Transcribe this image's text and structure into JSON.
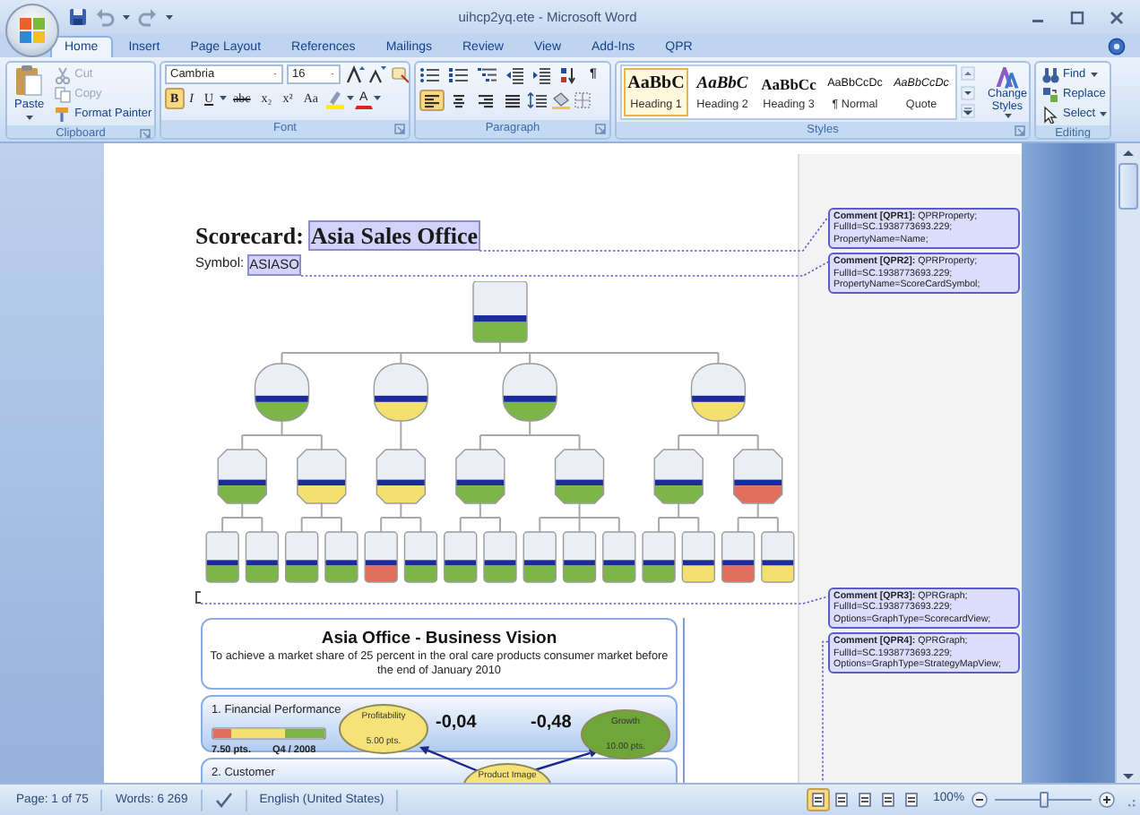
{
  "window": {
    "title": "uihcp2yq.ete - Microsoft Word"
  },
  "tabs": [
    {
      "label": "Home",
      "selected": true
    },
    {
      "label": "Insert",
      "selected": false
    },
    {
      "label": "Page Layout",
      "selected": false
    },
    {
      "label": "References",
      "selected": false
    },
    {
      "label": "Mailings",
      "selected": false
    },
    {
      "label": "Review",
      "selected": false
    },
    {
      "label": "View",
      "selected": false
    },
    {
      "label": "Add-Ins",
      "selected": false
    },
    {
      "label": "QPR",
      "selected": false
    }
  ],
  "ribbon": {
    "clipboard": {
      "label": "Clipboard",
      "paste": "Paste",
      "items": [
        {
          "label": "Cut",
          "kind": "cut",
          "disabled": true
        },
        {
          "label": "Copy",
          "kind": "copy",
          "disabled": true
        },
        {
          "label": "Format Painter",
          "kind": "format_painter",
          "disabled": false
        }
      ]
    },
    "font": {
      "label": "Font",
      "font_name": "Cambria",
      "font_size": "16",
      "format_buttons": [
        {
          "label": "B",
          "kind": "bold",
          "selected": true
        },
        {
          "label": "I",
          "kind": "italic",
          "selected": false
        },
        {
          "label": "U",
          "kind": "underline",
          "selected": false
        },
        {
          "label": "abc",
          "kind": "strike",
          "selected": false
        },
        {
          "label": "x₂",
          "kind": "plain",
          "selected": false
        },
        {
          "label": "x²",
          "kind": "plain",
          "selected": false
        },
        {
          "label": "Aa",
          "kind": "plain",
          "selected": false
        }
      ],
      "font_color": {
        "label": "A"
      }
    },
    "paragraph": {
      "label": "Paragraph",
      "show_marks": "¶",
      "alignments": [
        {
          "selected": true
        },
        {
          "selected": false
        },
        {
          "selected": false
        },
        {
          "selected": false
        }
      ]
    },
    "styles": {
      "label": "Styles",
      "items": [
        {
          "preview": "AaBbC",
          "name": "Heading 1",
          "kind": "heading1",
          "selected": true
        },
        {
          "preview": "AaBbC",
          "name": "Heading 2",
          "kind": "heading2",
          "selected": false
        },
        {
          "preview": "AaBbCc",
          "name": "Heading 3",
          "kind": "heading3",
          "selected": false
        },
        {
          "preview": "AaBbCcDc",
          "name": "¶ Normal",
          "kind": "normal",
          "selected": false
        },
        {
          "preview": "AaBbCcDc",
          "name": "Quote",
          "kind": "quote",
          "selected": false
        }
      ],
      "change_styles": "Change Styles"
    },
    "editing": {
      "label": "Editing",
      "items": [
        {
          "label": "Find",
          "kind": "find"
        },
        {
          "label": "Replace",
          "kind": "replace"
        },
        {
          "label": "Select",
          "kind": "select"
        }
      ]
    }
  },
  "document": {
    "heading": {
      "label": "Scorecard:",
      "value": "Asia Sales Office"
    },
    "symbol": {
      "label": "Symbol:",
      "value": "ASIASO"
    },
    "tree": {
      "kind": "scorecard",
      "color": "#7cb548",
      "children": [
        {
          "kind": "perspective",
          "color": "#7cb548",
          "children": [
            {
              "kind": "objective",
              "color": "#7cb548",
              "children": [
                {
                  "kind": "measure",
                  "color": "#7cb548"
                },
                {
                  "kind": "measure",
                  "color": "#7cb548"
                }
              ]
            },
            {
              "kind": "objective",
              "color": "#f3e06e",
              "children": [
                {
                  "kind": "measure",
                  "color": "#7cb548"
                },
                {
                  "kind": "measure",
                  "color": "#7cb548"
                }
              ]
            }
          ]
        },
        {
          "kind": "perspective",
          "color": "#f3e06e",
          "children": [
            {
              "kind": "objective",
              "color": "#f3e06e",
              "children": [
                {
                  "kind": "measure",
                  "color": "#e0705e"
                },
                {
                  "kind": "measure",
                  "color": "#7cb548"
                }
              ]
            }
          ]
        },
        {
          "kind": "perspective",
          "color": "#7cb548",
          "children": [
            {
              "kind": "objective",
              "color": "#7cb548",
              "children": [
                {
                  "kind": "measure",
                  "color": "#7cb548"
                },
                {
                  "kind": "measure",
                  "color": "#7cb548"
                }
              ]
            },
            {
              "kind": "objective",
              "color": "#7cb548",
              "children": [
                {
                  "kind": "measure",
                  "color": "#7cb548"
                },
                {
                  "kind": "measure",
                  "color": "#7cb548"
                },
                {
                  "kind": "measure",
                  "color": "#7cb548"
                }
              ]
            }
          ]
        },
        {
          "kind": "perspective",
          "color": "#f3e06e",
          "children": [
            {
              "kind": "objective",
              "color": "#7cb548",
              "children": [
                {
                  "kind": "measure",
                  "color": "#7cb548"
                },
                {
                  "kind": "measure",
                  "color": "#f3e06e"
                }
              ]
            },
            {
              "kind": "objective",
              "color": "#e0705e",
              "children": [
                {
                  "kind": "measure",
                  "color": "#e0705e"
                },
                {
                  "kind": "measure",
                  "color": "#f3e06e"
                }
              ]
            }
          ]
        }
      ]
    },
    "vision": {
      "title": "Asia Office - Business Vision",
      "text": "To achieve a market share of 25 percent in the oral care products consumer market before the end of January 2010",
      "perspectives": [
        {
          "name": "1. Financial Performance",
          "score": "7.50 pts.",
          "period": "Q4 / 2008"
        },
        {
          "name": "2. Customer"
        }
      ],
      "objectives": [
        {
          "name": "Profitability",
          "score": "5.00 pts.",
          "color": "#f5e37a"
        },
        {
          "name": "Growth",
          "score": "10.00 pts.",
          "color": "#6fa63a"
        },
        {
          "name": "Product Image",
          "color": "#f5e37a"
        }
      ],
      "links": [
        {
          "label": "-0,04"
        },
        {
          "label": "-0,48"
        }
      ]
    }
  },
  "comments": [
    {
      "text": "**Comment [QPR1]:** QPRProperty;\nFullId=SC.1938773693.229;\nPropertyName=Name;"
    },
    {
      "text": "**Comment [QPR2]:** QPRProperty;\nFullId=SC.1938773693.229;\nPropertyName=ScoreCardSymbol;"
    },
    {
      "text": "**Comment [QPR3]:** QPRGraph;\nFullId=SC.1938773693.229;\nOptions=GraphType=ScorecardView;"
    },
    {
      "text": "**Comment [QPR4]:** QPRGraph;\nFullId=SC.1938773693.229;\nOptions=GraphType=StrategyMapView;"
    }
  ],
  "status_bar": {
    "page": "Page: 1 of 75",
    "words": "Words: 6 269",
    "language": "English (United States)",
    "view_buttons": [
      {
        "selected": true
      },
      {
        "selected": false
      },
      {
        "selected": false
      },
      {
        "selected": false
      },
      {
        "selected": false
      }
    ],
    "zoom": "100%",
    "zoom_slider": {
      "level": 0.5
    }
  }
}
